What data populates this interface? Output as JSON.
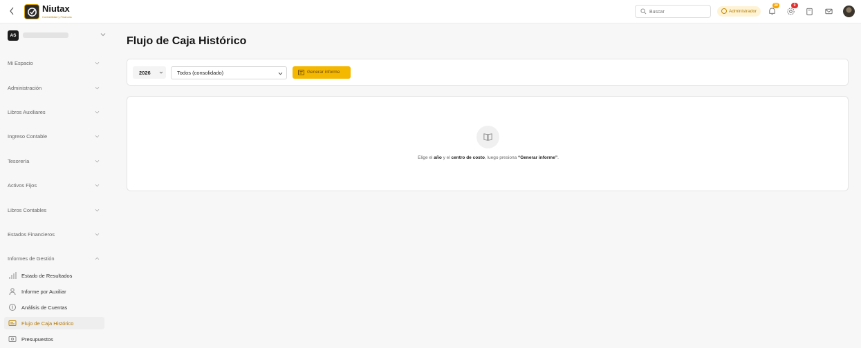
{
  "app": {
    "name": "Niutax",
    "tagline": "Contabilidad y Finanzas"
  },
  "topbar": {
    "search_placeholder": "Buscar",
    "role_badge": "Administrador",
    "notifications_count": "30",
    "settings_count": "0"
  },
  "workspace": {
    "initials": "AS"
  },
  "sidebar": {
    "items": [
      {
        "label": "Mi Espacio"
      },
      {
        "label": "Administración"
      },
      {
        "label": "Libros Auxiliares"
      },
      {
        "label": "Ingreso Contable"
      },
      {
        "label": "Tesorería"
      },
      {
        "label": "Activos Fijos"
      },
      {
        "label": "Libros Contables"
      },
      {
        "label": "Estados Financieros"
      },
      {
        "label": "Informes de Gestión"
      }
    ],
    "subitems": [
      {
        "label": "Estado de Resultados",
        "icon": "bar-chart-icon"
      },
      {
        "label": "Informe por Auxiliar",
        "icon": "users-icon"
      },
      {
        "label": "Análisis de Cuentas",
        "icon": "coin-icon"
      },
      {
        "label": "Flujo de Caja Histórico",
        "icon": "cash-icon",
        "active": true
      },
      {
        "label": "Presupuestos",
        "icon": "budget-icon"
      }
    ]
  },
  "main": {
    "title": "Flujo de Caja Histórico",
    "filters": {
      "year": "2026",
      "cost_center": "Todos (consolidado)",
      "generate_label": "Generar informe"
    },
    "empty_state": {
      "t1": "Elige el ",
      "b1": "año",
      "t2": " y el ",
      "b2": "centro de costo",
      "t3": ", luego presiona ",
      "b3": "“Generar informe”",
      "t4": "."
    }
  },
  "colors": {
    "accent": "#f5b800",
    "active_text": "#b57800"
  }
}
